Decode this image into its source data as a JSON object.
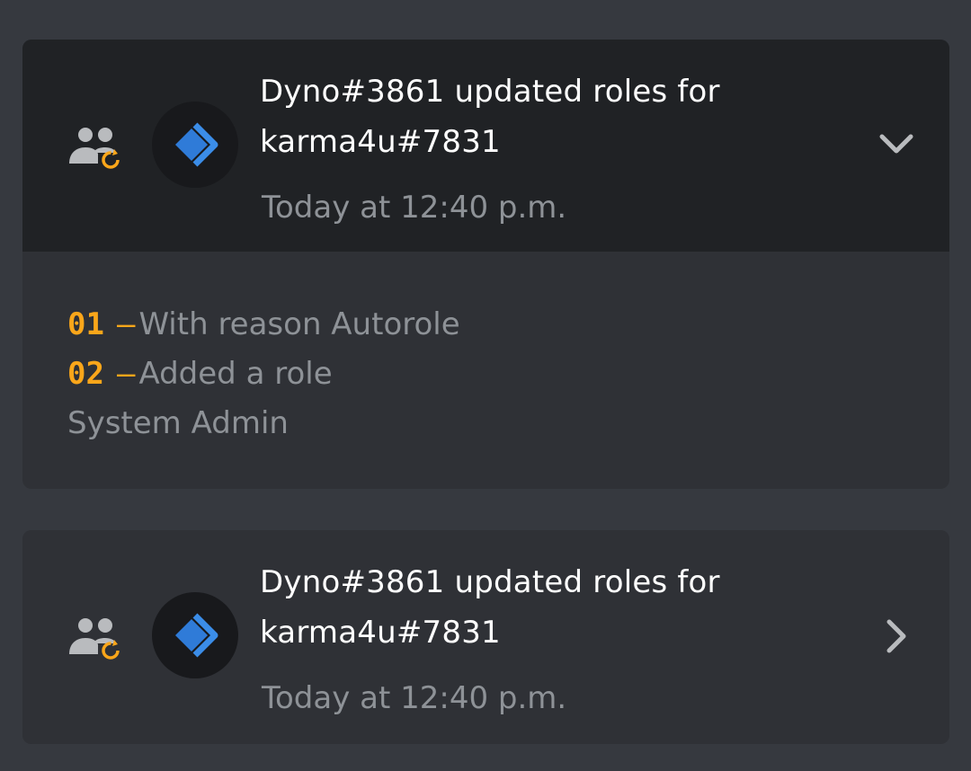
{
  "entries": [
    {
      "title": "Dyno#3861 updated roles for karma4u#7831",
      "timestamp": "Today at 12:40 p.m.",
      "expanded": true,
      "action_icon": "member-role-update-icon",
      "avatar_icon": "dyno-bot-avatar",
      "chevron_icon": "chevron-down-icon",
      "details": [
        {
          "number": "01",
          "dash": "—",
          "text": "With reason Autorole"
        },
        {
          "number": "02",
          "dash": "—",
          "text": "Added a role"
        }
      ],
      "role_name": "System Admin"
    },
    {
      "title": "Dyno#3861 updated roles for karma4u#7831",
      "timestamp": "Today at 12:40 p.m.",
      "expanded": false,
      "action_icon": "member-role-update-icon",
      "avatar_icon": "dyno-bot-avatar",
      "chevron_icon": "chevron-right-icon"
    }
  ],
  "colors": {
    "background": "#36393f",
    "card": "#2f3136",
    "card_header_expanded": "#202225",
    "accent_orange": "#faa61a",
    "muted_text": "#8e9297",
    "dyno_blue": "#2f7bd8"
  }
}
